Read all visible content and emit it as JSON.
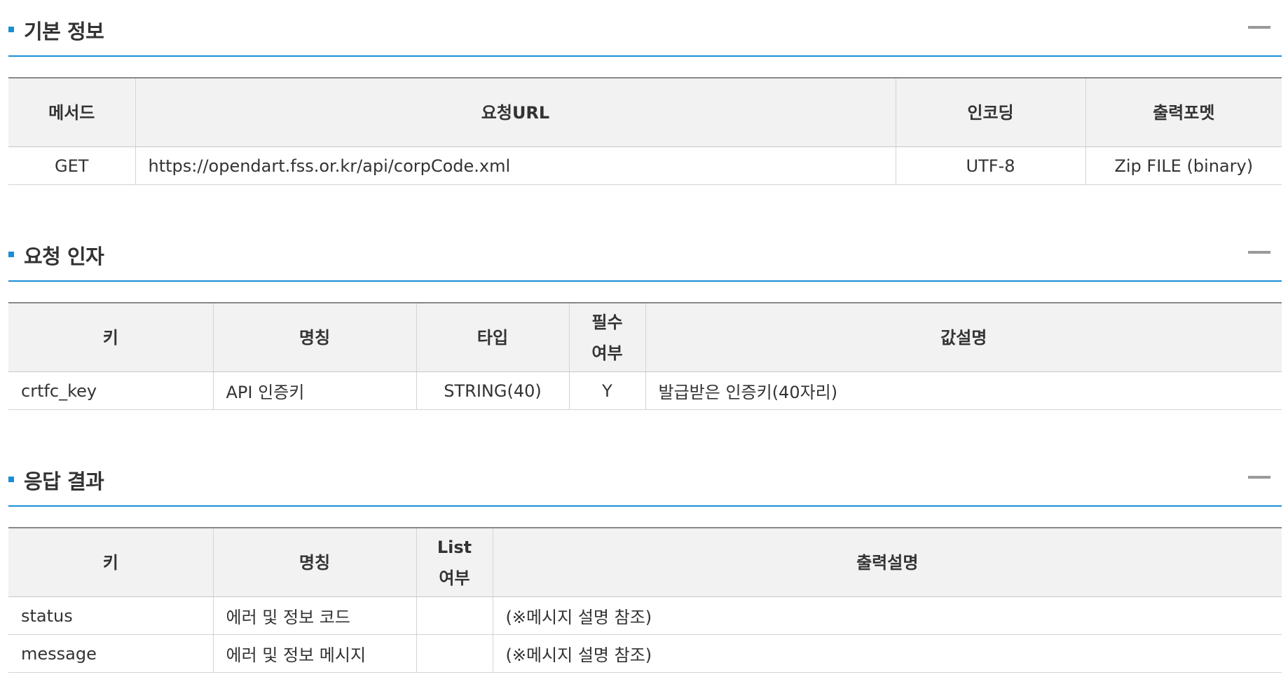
{
  "colors": {
    "accent": "#1a8fd6",
    "header_bg": "#f2f2f2",
    "text": "#333333",
    "collapse_icon": "#999999"
  },
  "basic_info": {
    "title": "기본 정보",
    "collapse_icon": "minus-icon",
    "headers": [
      "메서드",
      "요청URL",
      "인코딩",
      "출력포멧"
    ],
    "rows": [
      [
        "GET",
        "https://opendart.fss.or.kr/api/corpCode.xml",
        "UTF-8",
        "Zip FILE (binary)"
      ]
    ]
  },
  "request_params": {
    "title": "요청 인자",
    "collapse_icon": "minus-icon",
    "headers": [
      "키",
      "명칭",
      "타입",
      "필수\n여부",
      "값설명"
    ],
    "header_required_lines": [
      "필수",
      "여부"
    ],
    "rows": [
      [
        "crtfc_key",
        "API 인증키",
        "STRING(40)",
        "Y",
        "발급받은 인증키(40자리)"
      ]
    ]
  },
  "response_result": {
    "title": "응답 결과",
    "collapse_icon": "minus-icon",
    "headers": [
      "키",
      "명칭",
      "List\n여부",
      "출력설명"
    ],
    "header_list_lines": [
      "List",
      "여부"
    ],
    "rows": [
      [
        "status",
        "에러 및 정보 코드",
        "",
        "(※메시지 설명 참조)"
      ],
      [
        "message",
        "에러 및 정보 메시지",
        "",
        "(※메시지 설명 참조)"
      ]
    ]
  }
}
